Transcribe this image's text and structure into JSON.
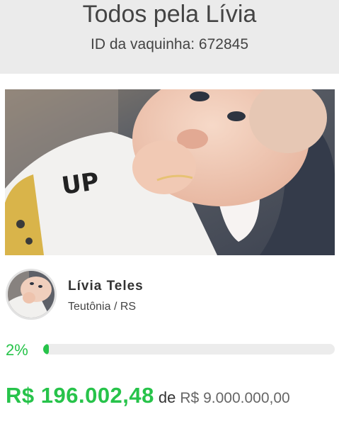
{
  "campaign": {
    "title": "Todos pela Lívia",
    "id_label": "ID da vaquinha: 672845"
  },
  "gallery": {
    "prev_icon": "chevron-left-icon",
    "shirt_text_1": "UP"
  },
  "owner": {
    "name": "Lívia Teles",
    "location": "Teutônia / RS"
  },
  "progress": {
    "percent_label": "2%",
    "fraction": 0.02
  },
  "funding": {
    "raised": "R$ 196.002,48",
    "connector": "de",
    "goal": "R$ 9.000.000,00"
  },
  "colors": {
    "accent": "#27c34a",
    "header_bg": "#ebebeb"
  }
}
